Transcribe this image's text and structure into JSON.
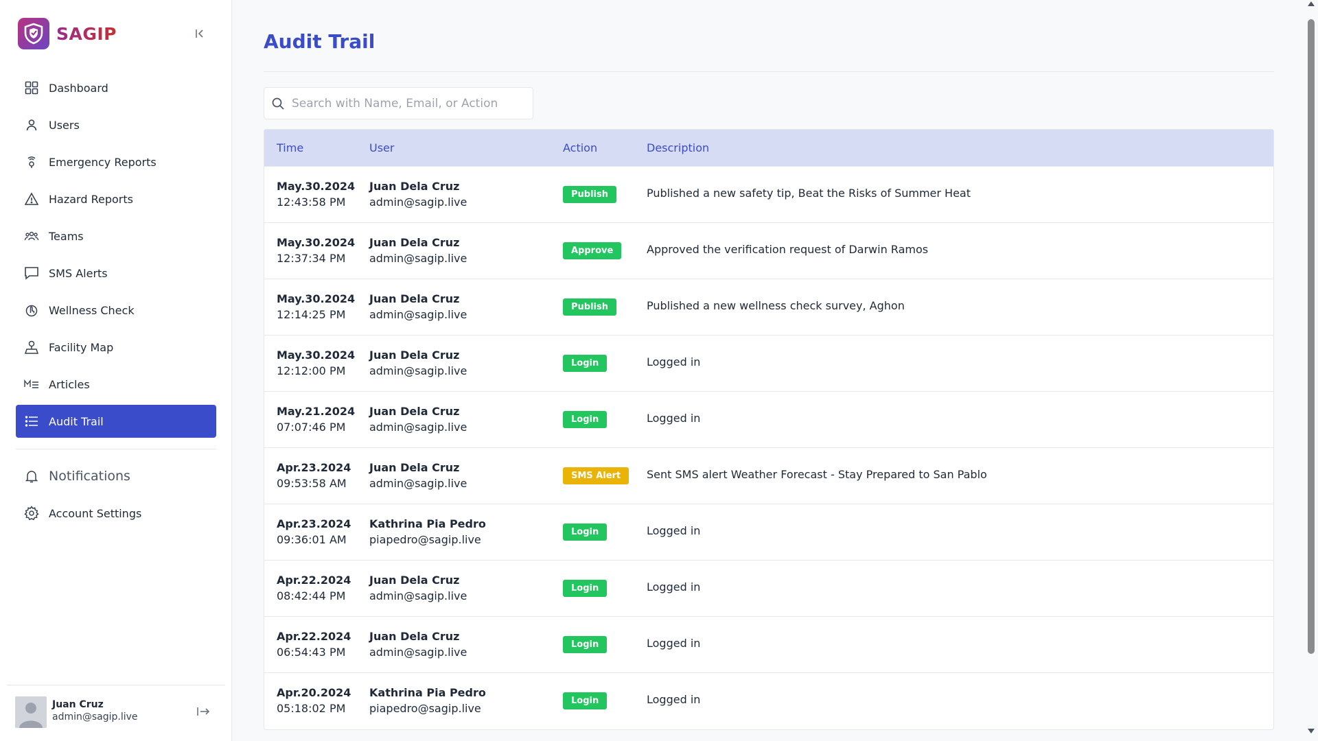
{
  "brand": {
    "name": "SAGIP"
  },
  "sidebar": {
    "items": [
      {
        "label": "Dashboard",
        "icon": "grid-icon"
      },
      {
        "label": "Users",
        "icon": "user-icon"
      },
      {
        "label": "Emergency Reports",
        "icon": "signal-pin-icon"
      },
      {
        "label": "Hazard Reports",
        "icon": "warning-icon"
      },
      {
        "label": "Teams",
        "icon": "team-icon"
      },
      {
        "label": "SMS Alerts",
        "icon": "message-icon"
      },
      {
        "label": "Wellness Check",
        "icon": "hand-pointer-icon"
      },
      {
        "label": "Facility Map",
        "icon": "map-pin-icon"
      },
      {
        "label": "Articles",
        "icon": "markdown-icon"
      },
      {
        "label": "Audit Trail",
        "icon": "list-icon",
        "active": true
      }
    ],
    "notifications_label": "Notifications",
    "account_settings_label": "Account Settings"
  },
  "user": {
    "name": "Juan Cruz",
    "email": "admin@sagip.live"
  },
  "page": {
    "title": "Audit Trail"
  },
  "search": {
    "placeholder": "Search with Name, Email, or Action",
    "value": ""
  },
  "table": {
    "headers": {
      "time": "Time",
      "user": "User",
      "action": "Action",
      "description": "Description"
    },
    "rows": [
      {
        "date": "May.30.2024",
        "time": "12:43:58 PM",
        "name": "Juan Dela Cruz",
        "email": "admin@sagip.live",
        "action": "Publish",
        "action_color": "#22c55e",
        "description": "Published a new safety tip, Beat the Risks of Summer Heat"
      },
      {
        "date": "May.30.2024",
        "time": "12:37:34 PM",
        "name": "Juan Dela Cruz",
        "email": "admin@sagip.live",
        "action": "Approve",
        "action_color": "#22c55e",
        "description": "Approved the verification request of Darwin Ramos"
      },
      {
        "date": "May.30.2024",
        "time": "12:14:25 PM",
        "name": "Juan Dela Cruz",
        "email": "admin@sagip.live",
        "action": "Publish",
        "action_color": "#22c55e",
        "description": "Published a new wellness check survey, Aghon"
      },
      {
        "date": "May.30.2024",
        "time": "12:12:00 PM",
        "name": "Juan Dela Cruz",
        "email": "admin@sagip.live",
        "action": "Login",
        "action_color": "#22c55e",
        "description": "Logged in"
      },
      {
        "date": "May.21.2024",
        "time": "07:07:46 PM",
        "name": "Juan Dela Cruz",
        "email": "admin@sagip.live",
        "action": "Login",
        "action_color": "#22c55e",
        "description": "Logged in"
      },
      {
        "date": "Apr.23.2024",
        "time": "09:53:58 AM",
        "name": "Juan Dela Cruz",
        "email": "admin@sagip.live",
        "action": "SMS Alert",
        "action_color": "#eab308",
        "description": "Sent SMS alert Weather Forecast - Stay Prepared to San Pablo"
      },
      {
        "date": "Apr.23.2024",
        "time": "09:36:01 AM",
        "name": "Kathrina Pia Pedro",
        "email": "piapedro@sagip.live",
        "action": "Login",
        "action_color": "#22c55e",
        "description": "Logged in"
      },
      {
        "date": "Apr.22.2024",
        "time": "08:42:44 PM",
        "name": "Juan Dela Cruz",
        "email": "admin@sagip.live",
        "action": "Login",
        "action_color": "#22c55e",
        "description": "Logged in"
      },
      {
        "date": "Apr.22.2024",
        "time": "06:54:43 PM",
        "name": "Juan Dela Cruz",
        "email": "admin@sagip.live",
        "action": "Login",
        "action_color": "#22c55e",
        "description": "Logged in"
      },
      {
        "date": "Apr.20.2024",
        "time": "05:18:02 PM",
        "name": "Kathrina Pia Pedro",
        "email": "piapedro@sagip.live",
        "action": "Login",
        "action_color": "#22c55e",
        "description": "Logged in"
      }
    ]
  },
  "colors": {
    "accent": "#3b4cca",
    "header_bg": "#d7dcf5"
  }
}
